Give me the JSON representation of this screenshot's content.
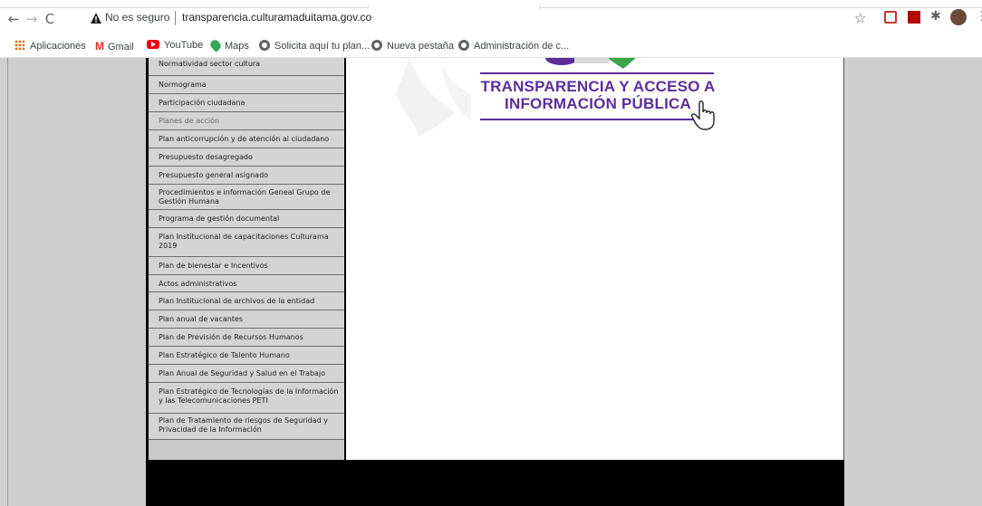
{
  "browser": {
    "nav": {
      "back": "←",
      "forward": "→",
      "reload": "C"
    },
    "security_label": "No es seguro",
    "url": "transparencia.culturamaduitama.gov.co",
    "star": "☆",
    "puzzle": "✱",
    "menu": "⋮"
  },
  "bookmarks": [
    {
      "label": "Aplicaciones",
      "icon": "apps-icon"
    },
    {
      "label": "Gmail",
      "icon": "gmail-icon"
    },
    {
      "label": "YouTube",
      "icon": "youtube-icon"
    },
    {
      "label": "Maps",
      "icon": "maps-icon"
    },
    {
      "label": "Solicita aquí tu plan...",
      "icon": "globe-icon"
    },
    {
      "label": "Nueva pestaña",
      "icon": "globe-icon"
    },
    {
      "label": "Administración de c...",
      "icon": "globe-icon"
    }
  ],
  "gmail_letter": "M",
  "sidebar": {
    "items": [
      {
        "label": "Normatividad sector cultura"
      },
      {
        "label": "Normograma"
      },
      {
        "label": "Participación ciudadana"
      },
      {
        "label": "Planes de acción"
      },
      {
        "label": "Plan anticorrupción y de atención al ciudadano"
      },
      {
        "label": "Presupuesto desagregado"
      },
      {
        "label": "Presupuesto general asignado"
      },
      {
        "label": "Procedimientos e información Geneal Grupo de Gestión Humana"
      },
      {
        "label": "Programa de gestión documental"
      },
      {
        "label": "Plan Institucional de capacitaciones Culturama 2019"
      },
      {
        "label": "Plan de bienestar e Incentivos"
      },
      {
        "label": "Actos administrativos"
      },
      {
        "label": "Plan Institucional de archivos de la entidad"
      },
      {
        "label": "Plan anual de vacantes"
      },
      {
        "label": "Plan de Previsión de Recursos Humanos"
      },
      {
        "label": "Plan Estratégico de Talento Humano"
      },
      {
        "label": "Plan Anual de Seguridad y Salud en el Trabajo"
      },
      {
        "label": "Plan Estratégico de Tecnologías de la Información y las Telecomunicaciones PETI"
      },
      {
        "label": "Plan de Tratamiento de riesgos de Seguridad y Privacidad de la Información"
      }
    ]
  },
  "main": {
    "title_line1": "TRANSPARENCIA Y ACCESO A",
    "title_line2": "INFORMACIÓN PÚBLICA",
    "accent_color": "#5b2e9a"
  }
}
